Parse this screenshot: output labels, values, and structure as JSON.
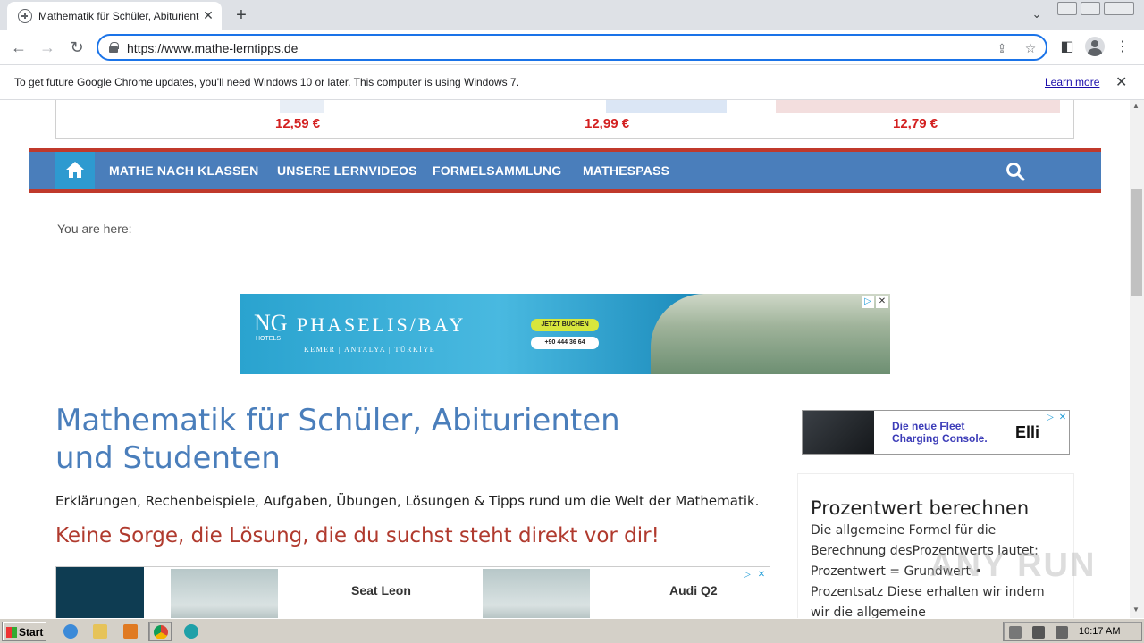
{
  "browser": {
    "tab_title": "Mathematik für Schüler, Abiturienten",
    "url": "https://www.mathe-lerntipps.de",
    "infobar_message": "To get future Google Chrome updates, you'll need Windows 10 or later. This computer is using Windows 7.",
    "infobar_link": "Learn more"
  },
  "top_ad": {
    "prices": [
      "12,59 €",
      "12,99 €",
      "12,79 €"
    ]
  },
  "nav": {
    "items": [
      "MATHE NACH KLASSEN",
      "UNSERE LERNVIDEOS",
      "FORMELSAMMLUNG",
      "MATHESPASS"
    ]
  },
  "breadcrumb": "You are here:",
  "phaselis_ad": {
    "logo": "NG",
    "hotels": "HOTELS",
    "brand": "PHASELIS/BAY",
    "location": "KEMER | ANTALYA | TÜRKİYE",
    "cta": "JETZT BUCHEN",
    "phone": "+90 444 36 64"
  },
  "main": {
    "title": "Mathematik für Schüler, Abiturienten und Studenten",
    "intro": "Erklärungen, Rechenbeispiele, Aufgaben, Übungen, Lösungen & Tipps rund um die Welt der Mathematik.",
    "slogan": "Keine Sorge, die Lösung, die du suchst steht direkt vor dir!"
  },
  "car_ad": {
    "cars": [
      "Seat Leon",
      "Audi Q2"
    ]
  },
  "elli_ad": {
    "line1": "Die neue Fleet",
    "line2": "Charging Console.",
    "logo": "Elli"
  },
  "sidebar": {
    "title": "Prozentwert berechnen",
    "body": "Die allgemeine Formel für die Berechnung desProzentwerts lautet: Prozentwert = Grundwert • Prozentsatz Diese erhalten wir indem wir die allgemeine"
  },
  "watermark": "ANY RUN",
  "taskbar": {
    "start": "Start",
    "time": "10:17 AM"
  },
  "colors": {
    "nav_bg": "#4a7ebb",
    "nav_border": "#c0392b",
    "title_blue": "#4a7ebb",
    "slogan_red": "#b03a2e",
    "price_red": "#d32020"
  }
}
